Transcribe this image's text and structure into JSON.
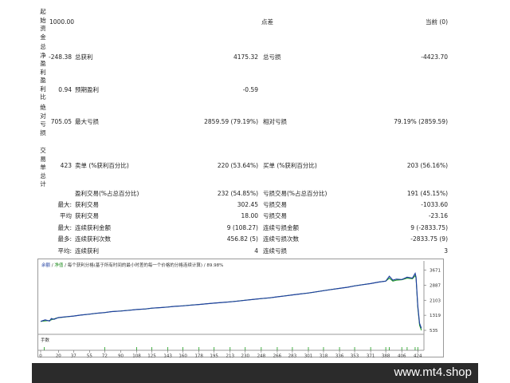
{
  "labels": {
    "initial_deposit": "起始资金",
    "total_net_profit": "总净盈利",
    "profit_factor": "盈利比",
    "absolute_drawdown": "绝对亏损",
    "total_trades": "交易单总计"
  },
  "values": {
    "initial_deposit": "1000.00",
    "total_net_profit": "-248.38",
    "profit_factor": "0.94",
    "absolute_drawdown": "705.05",
    "total_trades": "423"
  },
  "row1": {
    "mid": "点差",
    "right_label": "当前 (0)"
  },
  "row2": {
    "gross_profit_label": "总获利",
    "gross_profit": "4175.32",
    "gross_loss_label": "总亏损",
    "gross_loss": "-4423.70"
  },
  "row3": {
    "expected_payoff_label": "预期盈利",
    "expected_payoff": "-0.59"
  },
  "row4": {
    "maximal_dd_label": "最大亏损",
    "maximal_dd": "2859.59 (79.19%)",
    "relative_dd_label": "相对亏损",
    "relative_dd": "79.19% (2859.59)"
  },
  "row5": {
    "short_label": "卖单 (%获利百分比)",
    "short": "220 (53.64%)",
    "long_label": "买单 (%获利百分比)",
    "long": "203 (56.16%)"
  },
  "row6": {
    "profit_trades_label": "盈利交易(%占总百分比)",
    "profit_trades": "232 (54.85%)",
    "loss_trades_label": "亏损交易(%占总百分比)",
    "loss_trades": "191 (45.15%)"
  },
  "row7": {
    "prefix": "最大:",
    "label_a": "获利交易",
    "value_a": "302.45",
    "label_b": "亏损交易",
    "value_b": "-1033.60"
  },
  "row8": {
    "prefix": "平均",
    "label_a": "获利交易",
    "value_a": "18.00",
    "label_b": "亏损交易",
    "value_b": "-23.16"
  },
  "row9": {
    "prefix": "最大:",
    "label_a": "连续获利金额",
    "value_a": "9 (108.27)",
    "label_b": "连续亏损金额",
    "value_b": "9 (-2833.75)"
  },
  "row10": {
    "prefix": "最多:",
    "label_a": "连续获利次数",
    "value_a": "456.82 (5)",
    "label_b": "连续亏损次数",
    "value_b": "-2833.75 (9)"
  },
  "row11": {
    "prefix": "平均:",
    "label_a": "连续获利",
    "value_a": "4",
    "label_b": "连续亏损",
    "value_b": "3"
  },
  "chart_legend": {
    "balance": "余额",
    "sep": " / ",
    "equity": "净值",
    "rest": " / 每个获利分格(基于所有时间的最小时差的每一个价格的分格连续计算) / 89.98%"
  },
  "deposit_label": "手数",
  "watermark": "www.mt4.shop",
  "chart_data": {
    "type": "line",
    "y_ticks": [
      "3671",
      "2887",
      "2103",
      "1319",
      "535"
    ],
    "y_tick_values": [
      3671,
      2887,
      2103,
      1319,
      535
    ],
    "x_ticks": [
      "0",
      "20",
      "37",
      "55",
      "72",
      "90",
      "108",
      "125",
      "143",
      "160",
      "178",
      "195",
      "213",
      "230",
      "248",
      "266",
      "283",
      "301",
      "318",
      "336",
      "353",
      "371",
      "388",
      "406",
      "424"
    ],
    "x_tick_values": [
      0,
      20,
      37,
      55,
      72,
      90,
      108,
      125,
      143,
      160,
      178,
      195,
      213,
      230,
      248,
      266,
      283,
      301,
      318,
      336,
      353,
      371,
      388,
      406,
      424
    ],
    "ylim": [
      535,
      3900
    ],
    "xlim": [
      0,
      430
    ],
    "series": [
      {
        "x": [
          0,
          5,
          10,
          12,
          15,
          20,
          30,
          37,
          45,
          55,
          62,
          72,
          80,
          90,
          100,
          108,
          118,
          125,
          135,
          143,
          150,
          160,
          170,
          178,
          185,
          195,
          205,
          213,
          222,
          230,
          240,
          248,
          258,
          266,
          275,
          283,
          292,
          301,
          310,
          318,
          327,
          336,
          345,
          353,
          362,
          371,
          380,
          388,
          392,
          396,
          400,
          406,
          412,
          418,
          421,
          422,
          424,
          426,
          428
        ],
        "y": [
          1000,
          1080,
          1020,
          1150,
          1110,
          1200,
          1250,
          1280,
          1330,
          1380,
          1420,
          1460,
          1510,
          1540,
          1580,
          1620,
          1650,
          1690,
          1720,
          1750,
          1780,
          1810,
          1850,
          1880,
          1910,
          1950,
          1990,
          2020,
          2060,
          2100,
          2150,
          2190,
          2230,
          2280,
          2330,
          2380,
          2430,
          2480,
          2540,
          2600,
          2660,
          2720,
          2780,
          2850,
          2910,
          2970,
          3050,
          3100,
          3350,
          3150,
          3200,
          3180,
          3300,
          3250,
          3500,
          3300,
          1800,
          900,
          640
        ]
      },
      {
        "x": [
          0,
          10,
          18,
          30,
          37,
          45,
          55,
          62,
          72,
          80,
          90,
          100,
          108,
          118,
          125,
          135,
          143,
          150,
          160,
          170,
          178,
          185,
          195,
          205,
          213,
          222,
          230,
          240,
          248,
          258,
          266,
          275,
          283,
          292,
          301,
          310,
          318,
          327,
          336,
          345,
          353,
          362,
          371,
          380,
          388,
          392,
          396,
          400,
          406,
          412,
          418,
          421,
          422,
          424,
          426,
          428
        ],
        "y": [
          1000,
          1050,
          1180,
          1240,
          1280,
          1330,
          1380,
          1420,
          1460,
          1510,
          1540,
          1580,
          1620,
          1650,
          1690,
          1720,
          1750,
          1780,
          1810,
          1850,
          1880,
          1910,
          1950,
          1990,
          2020,
          2060,
          2100,
          2150,
          2190,
          2230,
          2280,
          2330,
          2380,
          2430,
          2480,
          2540,
          2600,
          2660,
          2720,
          2780,
          2850,
          2910,
          2970,
          3050,
          3100,
          3250,
          3100,
          3150,
          3170,
          3250,
          3220,
          3380,
          3250,
          1700,
          800,
          535
        ]
      }
    ],
    "lots_bars_x": [
      4,
      72,
      108,
      125,
      143,
      160,
      178,
      195,
      213,
      230,
      248,
      266,
      283,
      301,
      318,
      336,
      353,
      371,
      388,
      392,
      406,
      412,
      421,
      424
    ]
  }
}
